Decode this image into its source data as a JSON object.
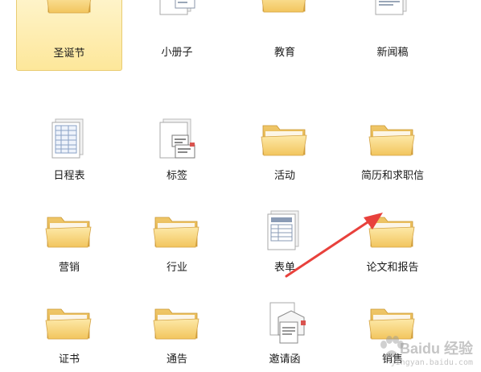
{
  "templates": [
    {
      "label": "圣诞节",
      "icon": "folder-icon",
      "selected": true
    },
    {
      "label": "小册子",
      "icon": "document-brochure-icon",
      "selected": false
    },
    {
      "label": "教育",
      "icon": "folder-icon",
      "selected": false
    },
    {
      "label": "新闻稿",
      "icon": "document-newsletter-icon",
      "selected": false
    },
    {
      "label": "日程表",
      "icon": "document-schedule-icon",
      "selected": false
    },
    {
      "label": "标签",
      "icon": "document-labels-icon",
      "selected": false
    },
    {
      "label": "活动",
      "icon": "folder-icon",
      "selected": false
    },
    {
      "label": "简历和求职信",
      "icon": "folder-icon",
      "selected": false
    },
    {
      "label": "营销",
      "icon": "folder-icon",
      "selected": false
    },
    {
      "label": "行业",
      "icon": "folder-icon",
      "selected": false
    },
    {
      "label": "表单",
      "icon": "document-form-icon",
      "selected": false
    },
    {
      "label": "论文和报告",
      "icon": "folder-icon",
      "selected": false
    },
    {
      "label": "证书",
      "icon": "folder-icon",
      "selected": false
    },
    {
      "label": "通告",
      "icon": "folder-icon",
      "selected": false
    },
    {
      "label": "邀请函",
      "icon": "document-invitation-icon",
      "selected": false
    },
    {
      "label": "销售",
      "icon": "folder-icon",
      "selected": false
    }
  ],
  "annotation": {
    "icon": "red-arrow-icon",
    "color": "#e8413c"
  },
  "watermark": {
    "logo_text": "Baidu 经验",
    "url": "jingyan.baidu.com"
  },
  "colors": {
    "folder_back": "#e8b94a",
    "folder_front": "#f7d67c",
    "selection_fill": "#fde79a"
  }
}
